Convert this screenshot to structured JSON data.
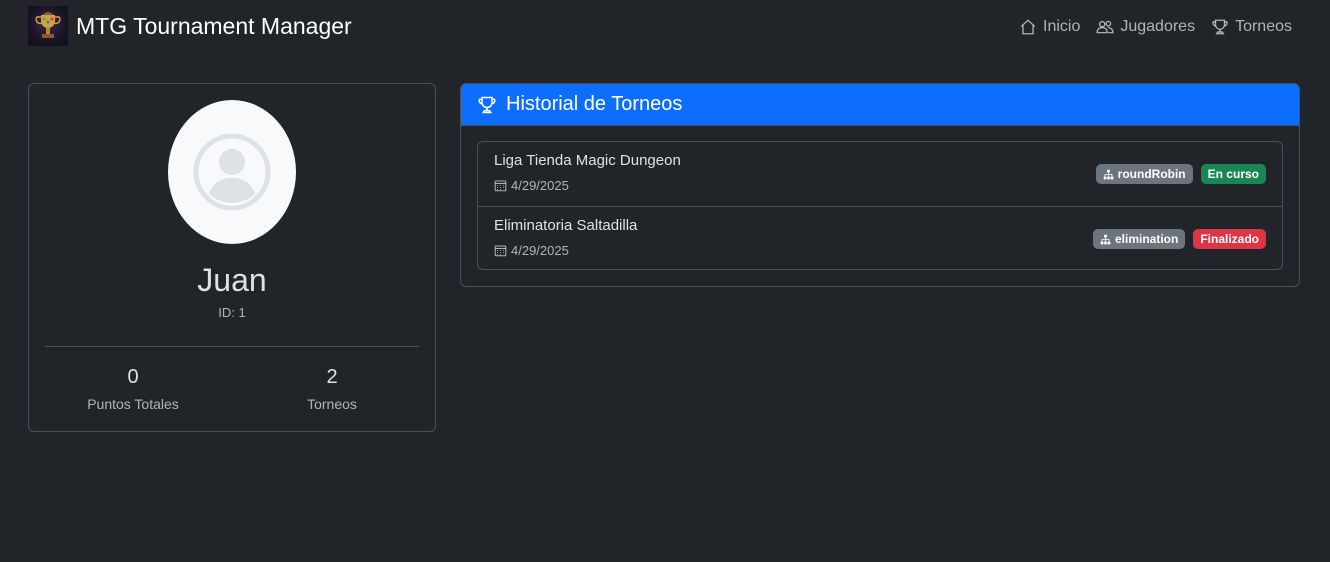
{
  "navbar": {
    "brand_title": "MTG Tournament Manager",
    "logo_icon": "trophy-logo",
    "links": [
      {
        "label": "Inicio",
        "icon": "house-icon"
      },
      {
        "label": "Jugadores",
        "icon": "people-icon"
      },
      {
        "label": "Torneos",
        "icon": "trophy-icon"
      }
    ]
  },
  "profile": {
    "name": "Juan",
    "id_text": "ID: 1",
    "stats": [
      {
        "value": "0",
        "label": "Puntos Totales"
      },
      {
        "value": "2",
        "label": "Torneos"
      }
    ]
  },
  "history": {
    "title": "Historial de Torneos",
    "header_color": "#0d6efd",
    "tournaments": [
      {
        "name": "Liga Tienda Magic Dungeon",
        "date": "4/29/2025",
        "format": "roundRobin",
        "status": "En curso",
        "status_color": "#198754"
      },
      {
        "name": "Eliminatoria Saltadilla",
        "date": "4/29/2025",
        "format": "elimination",
        "status": "Finalizado",
        "status_color": "#dc3545"
      }
    ]
  }
}
